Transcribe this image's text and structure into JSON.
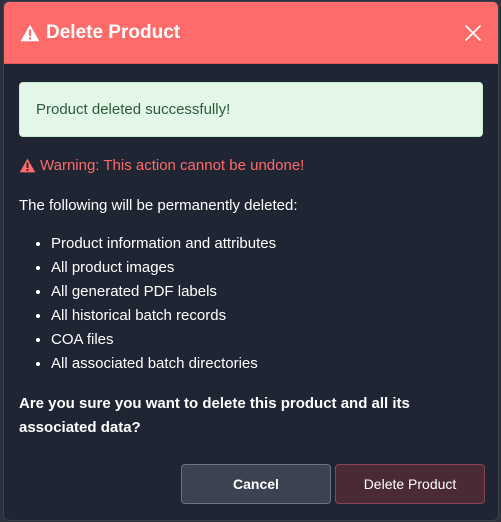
{
  "dialog": {
    "title": "Delete Product",
    "success_message": "Product deleted successfully!",
    "warning": "Warning: This action cannot be undone!",
    "intro": "The following will be permanently deleted:",
    "items": [
      "Product information and attributes",
      "All product images",
      "All generated PDF labels",
      "All historical batch records",
      "COA files",
      "All associated batch directories"
    ],
    "question": "Are you sure you want to delete this product and all its associated data?",
    "cancel_label": "Cancel",
    "delete_label": "Delete Product"
  },
  "icons": {
    "title_icon": "warning-triangle-icon",
    "warning_icon": "warning-triangle-icon",
    "close_icon": "close-icon"
  },
  "colors": {
    "header_bg": "#ff6b6b",
    "modal_bg": "#1f2533",
    "success_bg": "#e3f7e8",
    "success_text": "#2f5a3a",
    "warning_text": "#ff6b6b",
    "cancel_bg": "#3b4252",
    "delete_bg": "#4a2b35"
  }
}
